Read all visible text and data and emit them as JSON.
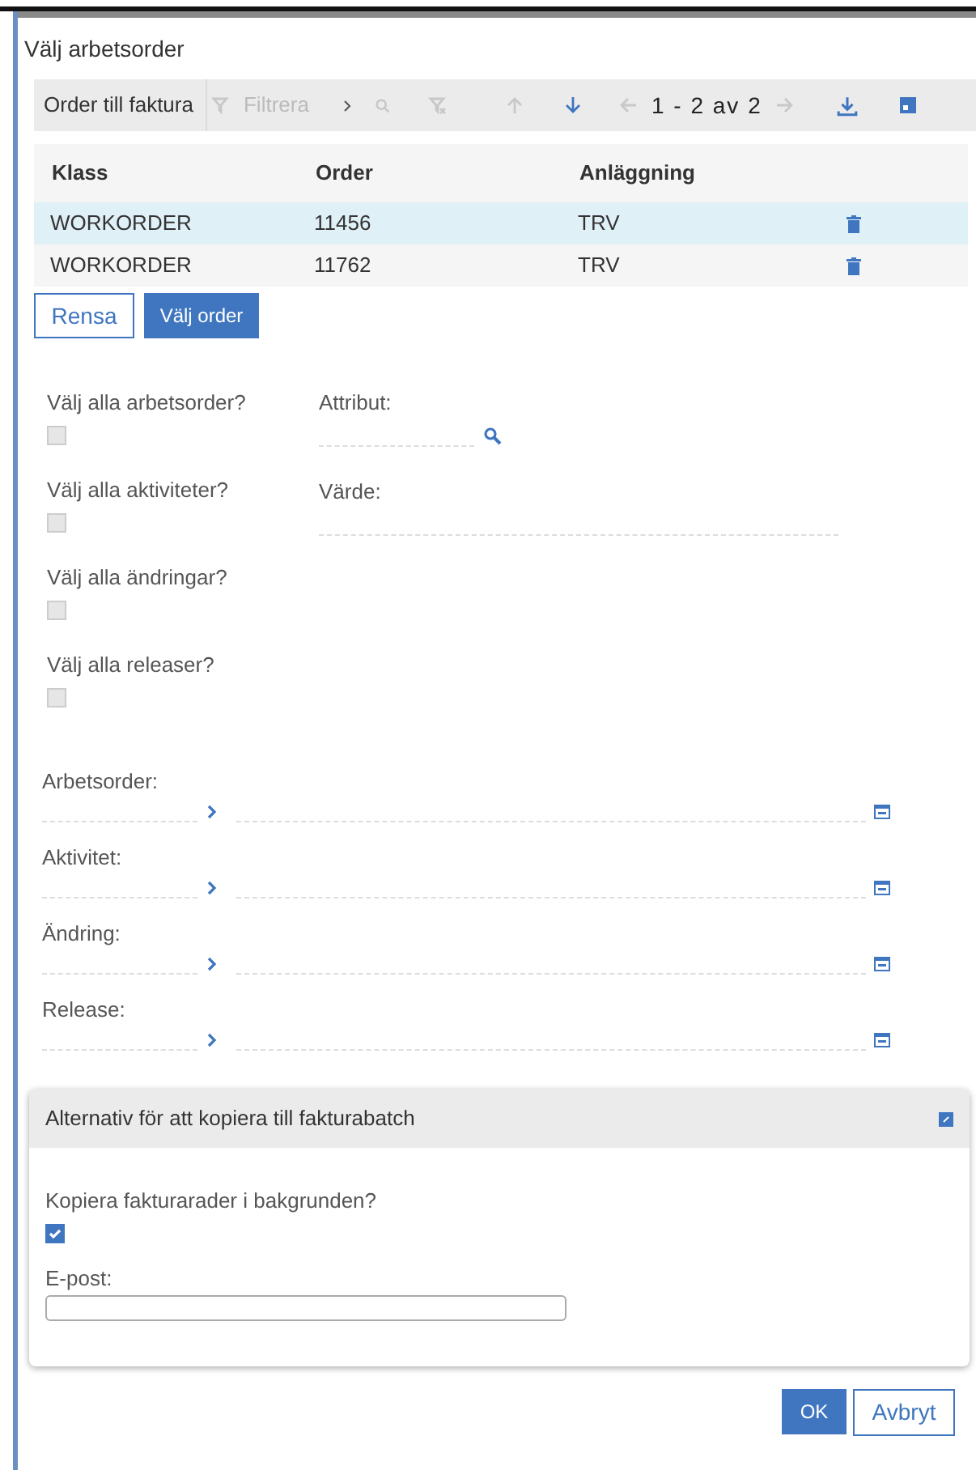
{
  "dialog": {
    "title": "Välj arbetsorder"
  },
  "table": {
    "title": "Order till faktura",
    "filter": {
      "placeholder": "Filtrera"
    },
    "pager": "1 - 2 av 2",
    "columns": [
      "Klass",
      "Order",
      "Anläggning"
    ],
    "rows": [
      {
        "cells": [
          "WORKORDER",
          "11456",
          "TRV"
        ],
        "selected": true
      },
      {
        "cells": [
          "WORKORDER",
          "11762",
          "TRV"
        ],
        "selected": false
      }
    ]
  },
  "table_buttons": [
    {
      "label": "Rensa",
      "kind": "secondary"
    },
    {
      "label": "Välj order",
      "kind": "primary"
    }
  ],
  "select_all": [
    {
      "label": "Välj alla arbetsorder?",
      "checked": false
    },
    {
      "label": "Välj alla aktiviteter?",
      "checked": false
    },
    {
      "label": "Välj alla ändringar?",
      "checked": false
    },
    {
      "label": "Välj alla releaser?",
      "checked": false
    }
  ],
  "attribute_fields": [
    {
      "label": "Attribut:",
      "kind": "lookup"
    },
    {
      "label": "Värde:",
      "kind": "text"
    }
  ],
  "ranges": [
    {
      "label": "Arbetsorder:"
    },
    {
      "label": "Aktivitet:"
    },
    {
      "label": "Ändring:"
    },
    {
      "label": "Release:"
    }
  ],
  "copy_panel": {
    "title": "Alternativ för att kopiera till fakturabatch",
    "background_label": "Kopiera fakturarader i bakgrunden?",
    "background_checked": true,
    "email_label": "E-post:"
  },
  "footer_buttons": [
    {
      "label": "OK",
      "kind": "primary"
    },
    {
      "label": "Avbryt",
      "kind": "secondary"
    }
  ]
}
